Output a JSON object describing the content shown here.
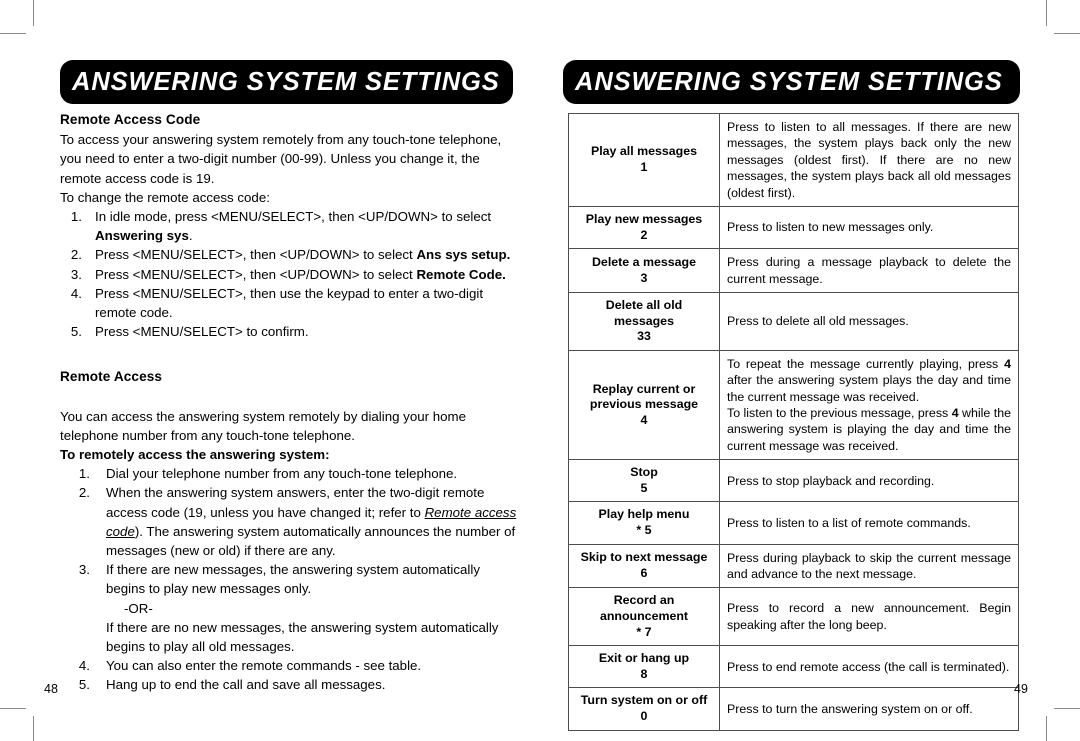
{
  "crop_marks": true,
  "left_page": {
    "banner_title": "ANSWERING SYSTEM SETTINGS",
    "page_number": "48",
    "section_remote_access_code": {
      "heading": "Remote Access Code",
      "intro": "To access your answering system remotely from any touch-tone telephone, you need to enter a two-digit number (00-99). Unless you change it, the remote access code is 19.",
      "lead_in": "To change the remote access code:",
      "steps": [
        {
          "num": "1.",
          "text_before": "In idle mode, press <MENU/SELECT>, then <UP/DOWN> to select ",
          "bold": "Answering sys",
          "text_after": "."
        },
        {
          "num": "2.",
          "text_before": "Press <MENU/SELECT>, then <UP/DOWN> to select ",
          "bold": "Ans sys setup.",
          "text_after": ""
        },
        {
          "num": "3.",
          "text_before": "Press <MENU/SELECT>, then <UP/DOWN> to select ",
          "bold": "Remote Code.",
          "text_after": ""
        },
        {
          "num": "4.",
          "text_before": "Press <MENU/SELECT>, then use the keypad to enter a two-digit remote code.",
          "bold": "",
          "text_after": ""
        },
        {
          "num": "5.",
          "text_before": "Press <MENU/SELECT> to confirm.",
          "bold": "",
          "text_after": ""
        }
      ]
    },
    "section_remote_access": {
      "heading": "Remote Access",
      "intro": "You can access the answering system remotely by dialing your home telephone number from any touch-tone telephone.",
      "lead_in_bold": "To remotely access the answering system:",
      "steps": [
        {
          "num": "1.",
          "text": "Dial your telephone number from any touch-tone telephone."
        },
        {
          "num": "2.",
          "text_part1": "When the answering system answers, enter the two-digit remote access code (19, unless you have changed it; refer to ",
          "italic_underline": "Remote access code",
          "text_part2": "). The answering system automatically announces the number of messages (new or old) if there are any."
        },
        {
          "num": "3.",
          "text_part1": "If there are new messages, the answering system automatically begins to play new messages only.",
          "or": "-OR-",
          "text_part2": "If there are no new messages, the answering system automatically begins to play all old messages."
        },
        {
          "num": "4.",
          "text": "You can also enter the remote commands - see table."
        },
        {
          "num": "5.",
          "text": "Hang up to end the call and save all messages."
        }
      ]
    }
  },
  "right_page": {
    "banner_title": "ANSWERING SYSTEM SETTINGS",
    "page_number": "49",
    "command_table": {
      "rows": [
        {
          "command": "Play all messages",
          "key": "1",
          "description": "Press to listen to all messages. If there are new messages, the system plays back only the new messages (oldest first). If there are no new messages, the system plays back all old messages (oldest first)."
        },
        {
          "command": "Play new messages",
          "key": "2",
          "description": "Press to listen to new messages only."
        },
        {
          "command": "Delete a message",
          "key": "3",
          "description": "Press during a message playback to delete the current message."
        },
        {
          "command": "Delete all old messages",
          "key": "33",
          "description": "Press to delete all old messages."
        },
        {
          "command": "Replay current or previous message",
          "key": "4",
          "description_line1_a": "To repeat the message currently playing, press ",
          "description_line1_key": "4",
          "description_line1_b": " after the answering system plays the day and time the current message was received.",
          "description_line2_a": "To listen to the previous message, press ",
          "description_line2_key": "4",
          "description_line2_b": " while the answering system is playing the day and time the current message was received."
        },
        {
          "command": "Stop",
          "key": "5",
          "description": "Press to stop playback and recording."
        },
        {
          "command": "Play help menu",
          "key": "* 5",
          "description": "Press to listen to a list of remote commands."
        },
        {
          "command": "Skip to next message",
          "key": "6",
          "description": "Press during playback to skip the current message and advance to the next message."
        },
        {
          "command": "Record an announcement",
          "key": "* 7",
          "description": "Press to record a new announcement. Begin speaking after the long beep."
        },
        {
          "command": "Exit or hang up",
          "key": "8",
          "description": "Press to end remote access (the call is terminated)."
        },
        {
          "command": "Turn system on or off",
          "key": "0",
          "description": "Press to turn the answering system on or off."
        }
      ]
    }
  }
}
